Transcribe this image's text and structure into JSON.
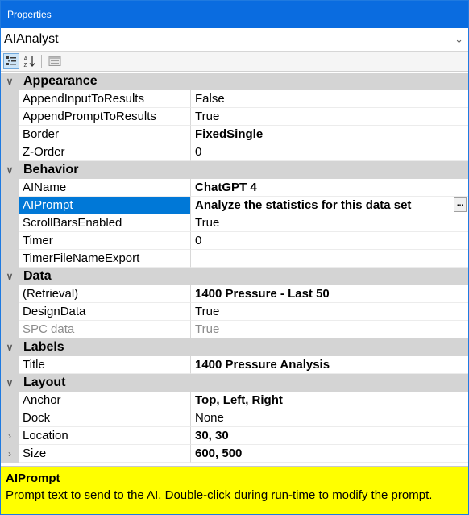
{
  "window": {
    "title": "Properties"
  },
  "object_selector": {
    "value": "AIAnalyst",
    "icon": "chevron-down-icon"
  },
  "toolbar": {
    "buttons": [
      {
        "name": "categorized",
        "icon": "categorized-icon",
        "active": true
      },
      {
        "name": "alphabetical",
        "icon": "sort-az-icon",
        "active": false
      },
      {
        "name": "property-pages",
        "icon": "property-pages-icon",
        "active": false
      }
    ]
  },
  "categories": [
    {
      "label": "Appearance",
      "rows": [
        {
          "name": "AppendInputToResults",
          "value": "False"
        },
        {
          "name": "AppendPromptToResults",
          "value": "True"
        },
        {
          "name": "Border",
          "value": "FixedSingle"
        },
        {
          "name": "Z-Order",
          "value": "0"
        }
      ]
    },
    {
      "label": "Behavior",
      "rows": [
        {
          "name": "AIName",
          "value": "ChatGPT 4"
        },
        {
          "name": "AIPrompt",
          "value": "Analyze the statistics for this data set"
        },
        {
          "name": "ScrollBarsEnabled",
          "value": "True"
        },
        {
          "name": "Timer",
          "value": "0"
        },
        {
          "name": "TimerFileNameExport",
          "value": ""
        }
      ]
    },
    {
      "label": "Data",
      "rows": [
        {
          "name": "(Retrieval)",
          "value": "1400 Pressure - Last 50"
        },
        {
          "name": "DesignData",
          "value": "True"
        },
        {
          "name": "SPC data",
          "value": "True"
        }
      ]
    },
    {
      "label": "Labels",
      "rows": [
        {
          "name": "Title",
          "value": "1400 Pressure Analysis"
        }
      ]
    },
    {
      "label": "Layout",
      "rows": [
        {
          "name": "Anchor",
          "value": "Top, Left, Right"
        },
        {
          "name": "Dock",
          "value": "None"
        },
        {
          "name": "Location",
          "value": "30, 30"
        },
        {
          "name": "Size",
          "value": "600, 500"
        }
      ]
    }
  ],
  "selected_row": {
    "ellipsis_label": "..."
  },
  "description": {
    "title": "AIPrompt",
    "text": "Prompt text to send to the AI. Double-click during run-time to modify the prompt."
  },
  "colors": {
    "accent": "#0a6ce0",
    "selection": "#0078d7",
    "description_bg": "#ffff00",
    "category_bg": "#d4d4d4"
  }
}
